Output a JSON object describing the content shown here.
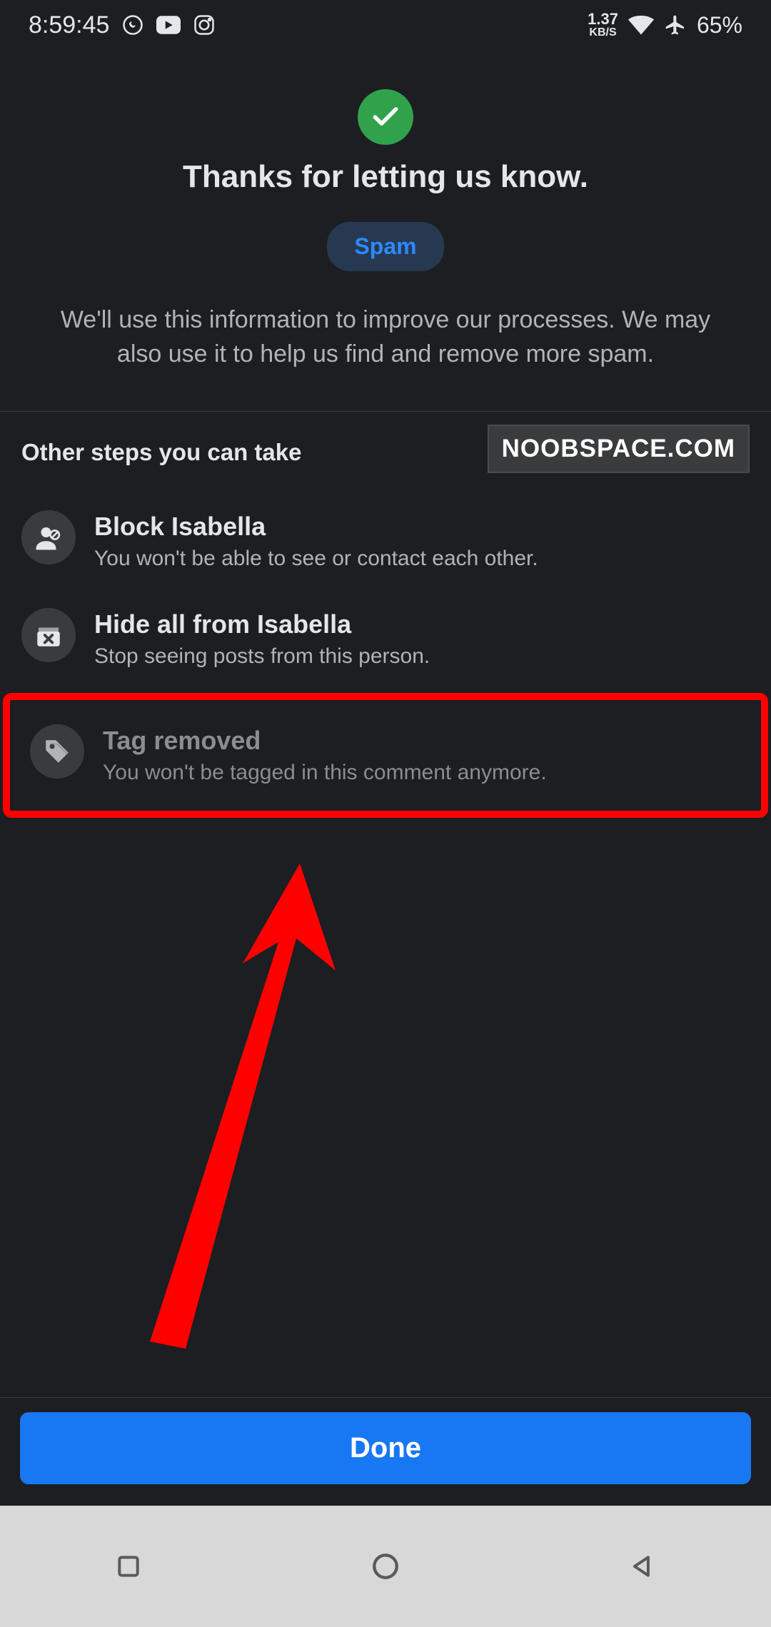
{
  "status": {
    "time": "8:59:45",
    "kbs": "1.37",
    "kbs_label": "KB/S",
    "battery": "65%"
  },
  "header": {
    "title": "Thanks for letting us know.",
    "chip": "Spam",
    "info": "We'll use this information to improve our processes. We may also use it to help us find and remove more spam."
  },
  "steps": {
    "title": "Other steps you can take",
    "watermark": "NOOBSPACE.COM",
    "items": [
      {
        "title": "Block Isabella",
        "sub": "You won't be able to see or contact each other."
      },
      {
        "title": "Hide all from Isabella",
        "sub": "Stop seeing posts from this person."
      },
      {
        "title": "Tag removed",
        "sub": "You won't be tagged in this comment anymore."
      }
    ]
  },
  "done": "Done"
}
